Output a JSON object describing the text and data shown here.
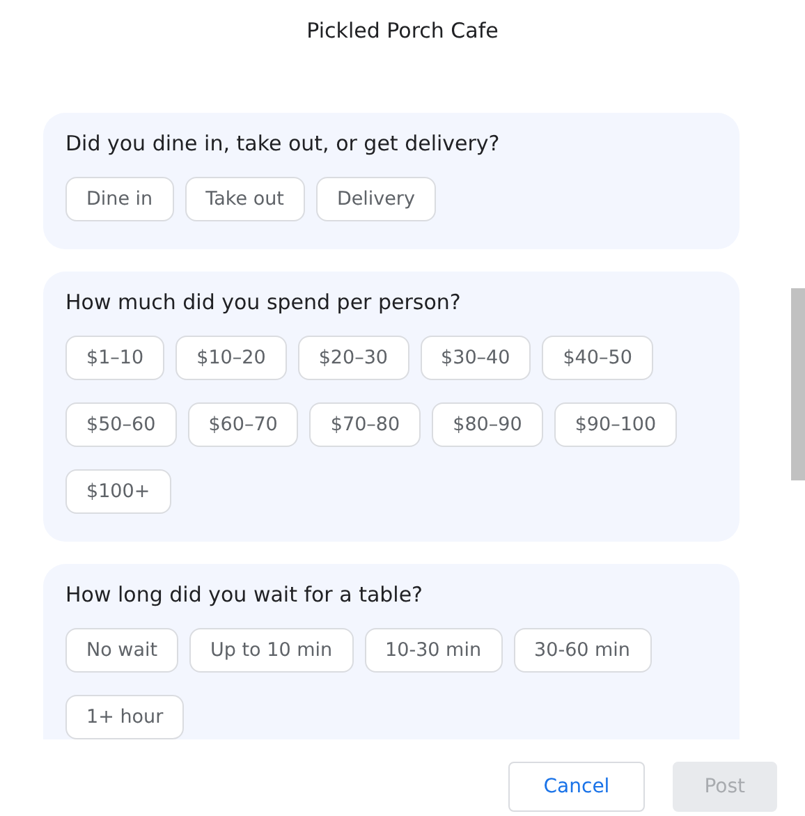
{
  "title": "Pickled Porch Cafe",
  "questions": [
    {
      "text": "Did you dine in, take out, or get delivery?",
      "options": [
        {
          "label": "Dine in",
          "selected": false
        },
        {
          "label": "Take out",
          "selected": false
        },
        {
          "label": "Delivery",
          "selected": false
        }
      ]
    },
    {
      "text": "How much did you spend per person?",
      "options": [
        {
          "label": "$1–10",
          "selected": false
        },
        {
          "label": "$10–20",
          "selected": false
        },
        {
          "label": "$20–30",
          "selected": false
        },
        {
          "label": "$30–40",
          "selected": false
        },
        {
          "label": "$40–50",
          "selected": false
        },
        {
          "label": "$50–60",
          "selected": false
        },
        {
          "label": "$60–70",
          "selected": false
        },
        {
          "label": "$70–80",
          "selected": false
        },
        {
          "label": "$80–90",
          "selected": false
        },
        {
          "label": "$90–100",
          "selected": false
        },
        {
          "label": "$100+",
          "selected": false
        }
      ]
    },
    {
      "text": "How long did you wait for a table?",
      "options": [
        {
          "label": "No wait",
          "selected": false
        },
        {
          "label": "Up to 10 min",
          "selected": false
        },
        {
          "label": "10-30 min",
          "selected": false
        },
        {
          "label": "30-60 min",
          "selected": false
        },
        {
          "label": "1+ hour",
          "selected": false
        }
      ]
    }
  ],
  "buttons": [
    {
      "label": "Cancel",
      "disabled": false
    },
    {
      "label": "Post",
      "disabled": true
    }
  ]
}
